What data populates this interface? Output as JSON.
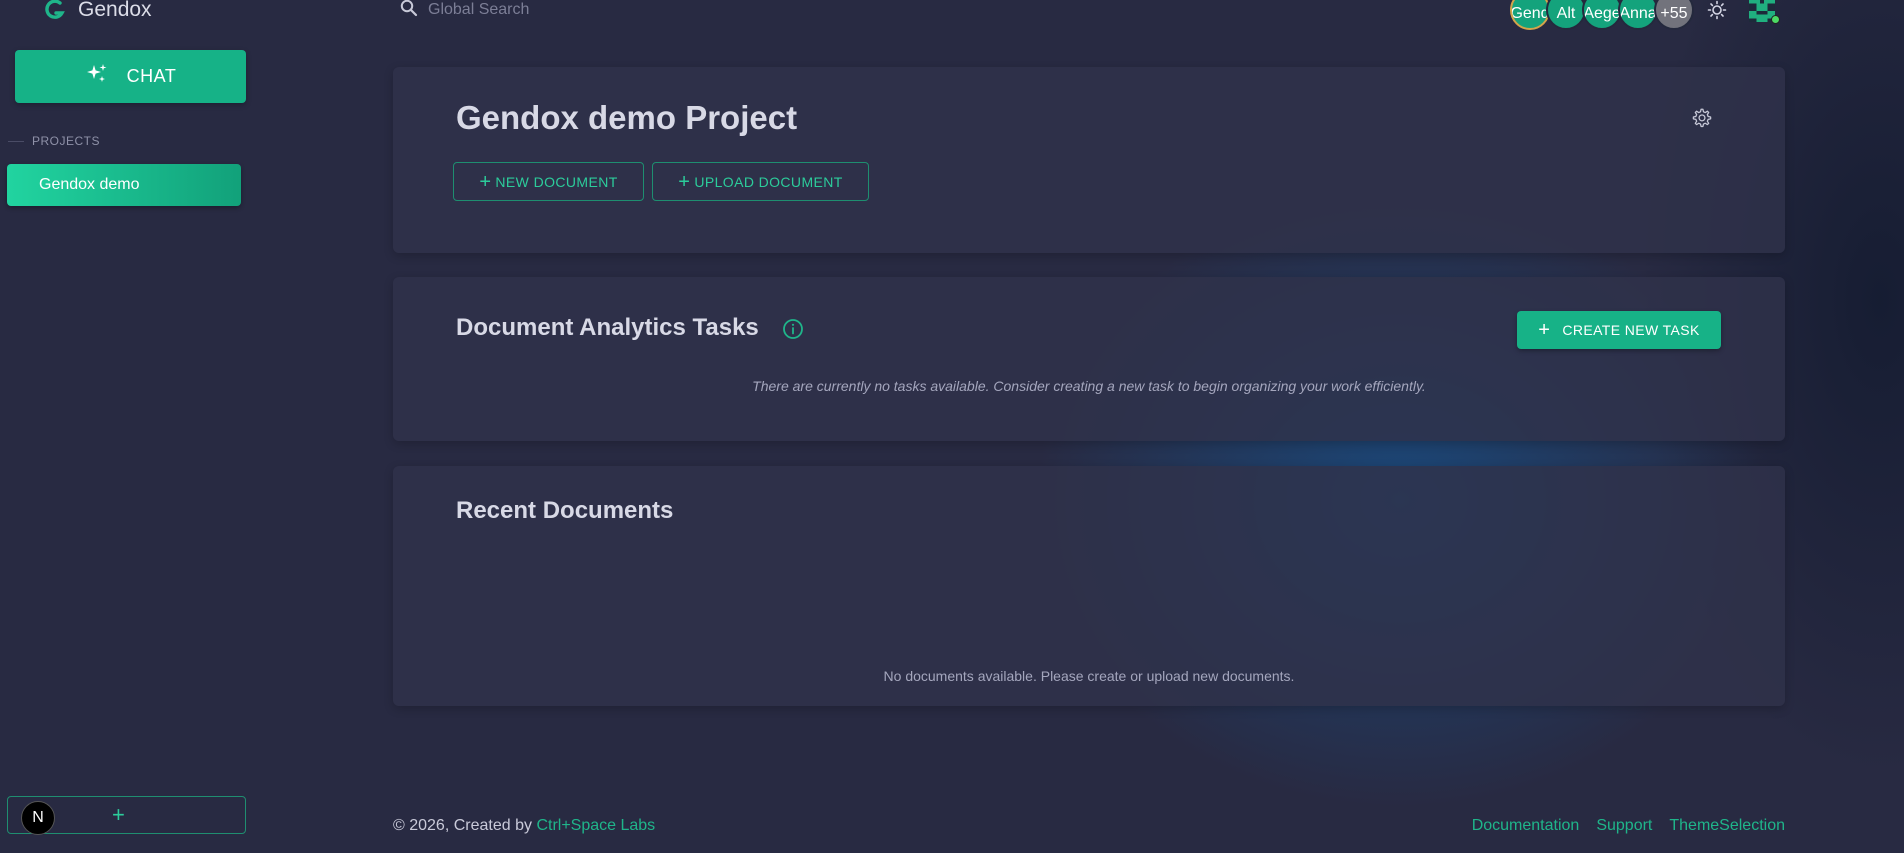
{
  "app": {
    "name": "Gendox"
  },
  "sidebar": {
    "chat_label": "CHAT",
    "projects_heading": "PROJECTS",
    "projects": [
      {
        "label": "Gendox demo",
        "active": true
      }
    ],
    "bottom_badge": "N",
    "bottom_add": "+"
  },
  "topbar": {
    "search_placeholder": "Global Search",
    "avatars": [
      "Gend",
      "Alt",
      "Aege",
      "Anna",
      "+55"
    ]
  },
  "project": {
    "title": "Gendox demo Project",
    "new_document_label": "NEW DOCUMENT",
    "upload_document_label": "UPLOAD DOCUMENT"
  },
  "tasks": {
    "title": "Document Analytics Tasks",
    "create_label": "CREATE NEW TASK",
    "empty_message": "There are currently no tasks available. Consider creating a new task to begin organizing your work efficiently."
  },
  "documents": {
    "title": "Recent Documents",
    "empty_message": "No documents available. Please create or upload new documents."
  },
  "footer": {
    "copyright_prefix": "© 2026, Created by",
    "company_link": "Ctrl+Space Labs",
    "links": [
      "Documentation",
      "Support",
      "ThemeSelection"
    ]
  },
  "colors": {
    "accent": "#16b287",
    "background": "#282a42",
    "card": "#30324a"
  }
}
